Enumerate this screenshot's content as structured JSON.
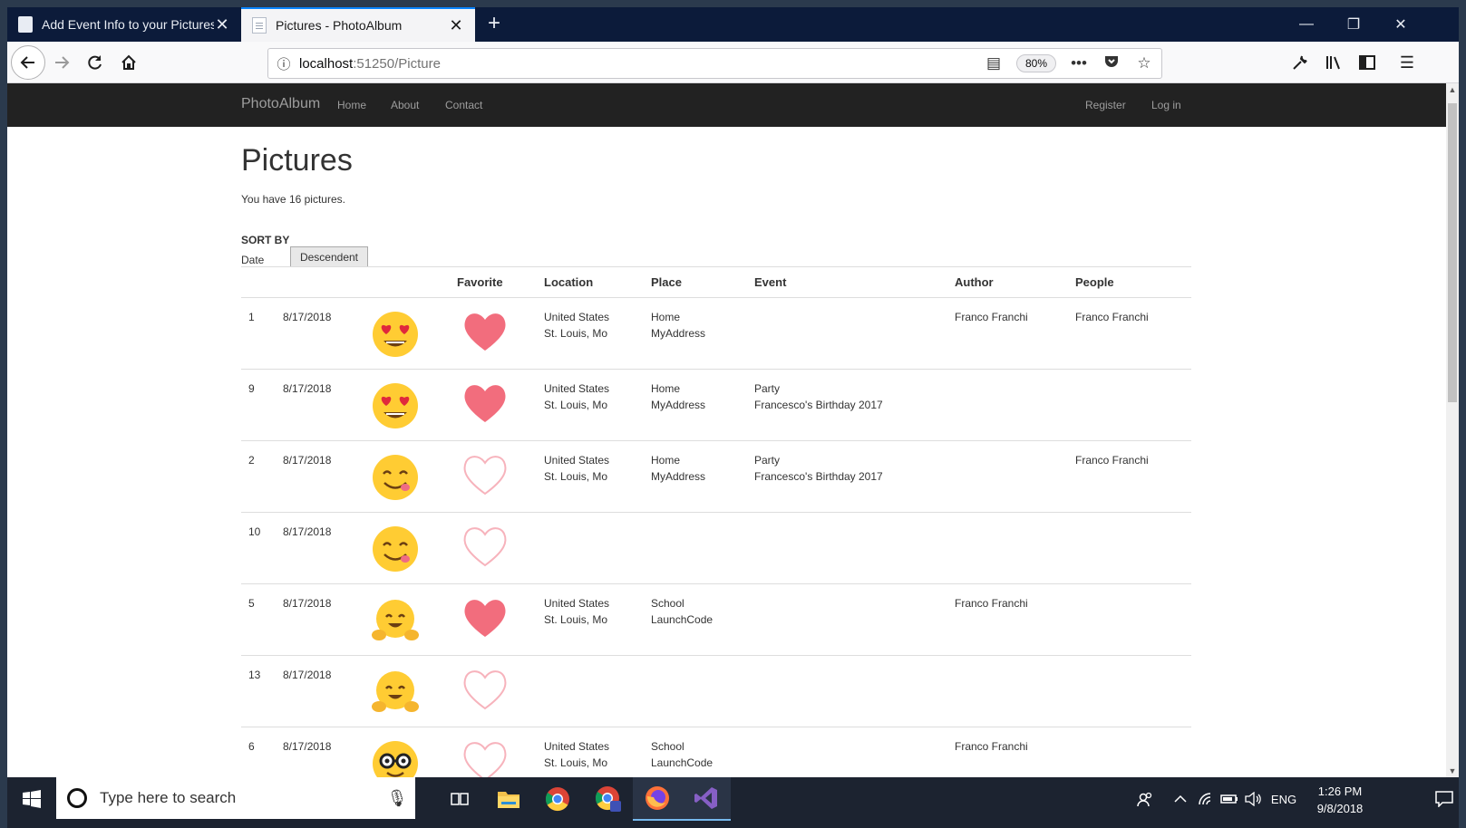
{
  "browser": {
    "tabs": [
      {
        "title": "Add Event Info to your Pictures",
        "active": false
      },
      {
        "title": "Pictures - PhotoAlbum",
        "active": true
      }
    ],
    "url_host": "localhost",
    "url_rest": ":51250/Picture",
    "zoom": "80%"
  },
  "site": {
    "brand": "PhotoAlbum",
    "nav": [
      "Home",
      "About",
      "Contact"
    ],
    "auth": [
      "Register",
      "Log in"
    ]
  },
  "page": {
    "title": "Pictures",
    "count_text": "You have 16 pictures.",
    "sort_by_label": "SORT BY",
    "sort_field": "Date",
    "sort_direction": "Descendent"
  },
  "table": {
    "headers": [
      "",
      "",
      "",
      "Favorite",
      "Location",
      "Place",
      "Event",
      "Author",
      "People"
    ],
    "rows": [
      {
        "id": "1",
        "date": "8/17/2018",
        "emoji": "heart-eyes-emoji",
        "favorite": true,
        "location1": "United States",
        "location2": "St. Louis, Mo",
        "place1": "Home",
        "place2": "MyAddress",
        "event1": "",
        "event2": "",
        "author": "Franco Franchi",
        "people": "Franco Franchi"
      },
      {
        "id": "9",
        "date": "8/17/2018",
        "emoji": "heart-eyes-emoji",
        "favorite": true,
        "location1": "United States",
        "location2": "St. Louis, Mo",
        "place1": "Home",
        "place2": "MyAddress",
        "event1": "Party",
        "event2": "Francesco's Birthday 2017",
        "author": "",
        "people": ""
      },
      {
        "id": "2",
        "date": "8/17/2018",
        "emoji": "yum-emoji",
        "favorite": false,
        "location1": "United States",
        "location2": "St. Louis, Mo",
        "place1": "Home",
        "place2": "MyAddress",
        "event1": "Party",
        "event2": "Francesco's Birthday 2017",
        "author": "",
        "people": "Franco Franchi"
      },
      {
        "id": "10",
        "date": "8/17/2018",
        "emoji": "yum-emoji",
        "favorite": false,
        "location1": "",
        "location2": "",
        "place1": "",
        "place2": "",
        "event1": "",
        "event2": "",
        "author": "",
        "people": ""
      },
      {
        "id": "5",
        "date": "8/17/2018",
        "emoji": "hug-emoji",
        "favorite": true,
        "location1": "United States",
        "location2": "St. Louis, Mo",
        "place1": "School",
        "place2": "LaunchCode",
        "event1": "",
        "event2": "",
        "author": "Franco Franchi",
        "people": ""
      },
      {
        "id": "13",
        "date": "8/17/2018",
        "emoji": "hug-emoji",
        "favorite": false,
        "location1": "",
        "location2": "",
        "place1": "",
        "place2": "",
        "event1": "",
        "event2": "",
        "author": "",
        "people": ""
      },
      {
        "id": "6",
        "date": "8/17/2018",
        "emoji": "nerd-emoji",
        "favorite": false,
        "location1": "United States",
        "location2": "St. Louis, Mo",
        "place1": "School",
        "place2": "LaunchCode",
        "event1": "",
        "event2": "",
        "author": "Franco Franchi",
        "people": ""
      }
    ]
  },
  "taskbar": {
    "search_placeholder": "Type here to search",
    "lang": "ENG",
    "time": "1:26 PM",
    "date": "9/8/2018"
  },
  "colors": {
    "heart": "#f26d7d",
    "heart_outline": "#f7b3bc",
    "emoji_yellow": "#ffcc33",
    "site_nav": "#222222",
    "tab_strip": "#0c1b3a"
  }
}
